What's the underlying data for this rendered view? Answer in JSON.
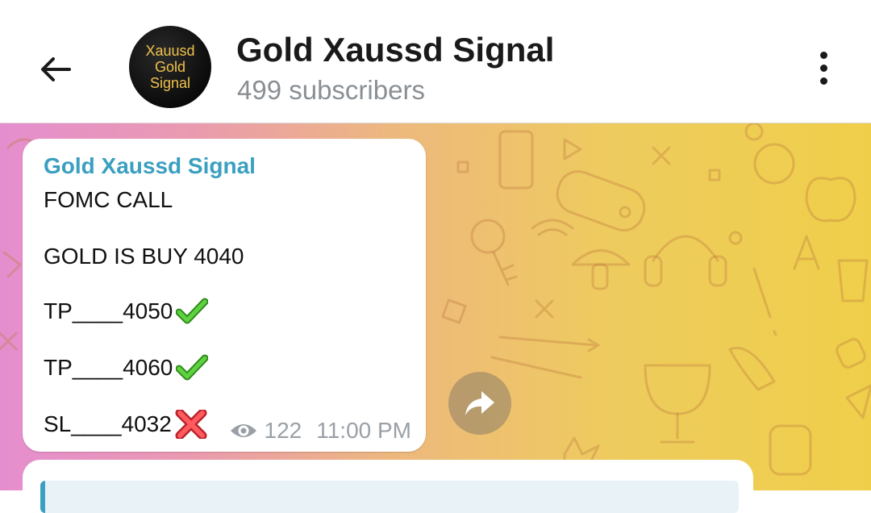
{
  "header": {
    "title": "Gold Xaussd Signal",
    "subtitle": "499 subscribers",
    "avatar_lines": [
      "Xauusd",
      "Gold",
      "Signal"
    ]
  },
  "message": {
    "sender": "Gold Xaussd Signal",
    "lines": [
      {
        "text": "FOMC CALL",
        "mark": null
      },
      {
        "text": "GOLD IS BUY 4040",
        "mark": null
      },
      {
        "text": "TP____4050",
        "mark": "check"
      },
      {
        "text": "TP____4060",
        "mark": "check"
      },
      {
        "text": "SL____4032",
        "mark": "cross"
      }
    ],
    "views": "122",
    "time": "11:00 PM"
  },
  "colors": {
    "accent": "#3a9fc0",
    "check": "#43b02a",
    "cross": "#e0393e"
  },
  "icons": {
    "back": "arrow-left-icon",
    "menu": "more-vertical-icon",
    "views": "eye-icon",
    "share": "share-arrow-icon"
  }
}
